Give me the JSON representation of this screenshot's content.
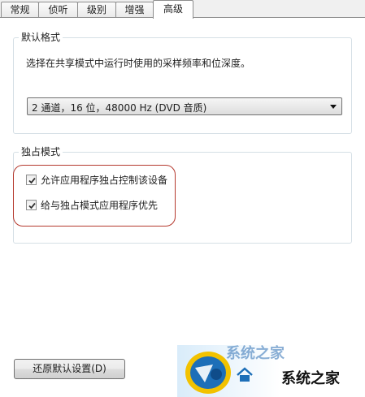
{
  "tabs": [
    {
      "label": "常规"
    },
    {
      "label": "侦听"
    },
    {
      "label": "级别"
    },
    {
      "label": "增强"
    },
    {
      "label": "高级"
    }
  ],
  "active_tab": "高级",
  "default_format": {
    "title": "默认格式",
    "description": "选择在共享模式中运行时使用的采样频率和位深度。",
    "selected": "2 通道，16 位，48000 Hz (DVD 音质)"
  },
  "exclusive_mode": {
    "title": "独占模式",
    "options": [
      {
        "label": "允许应用程序独占控制该设备",
        "checked": true
      },
      {
        "label": "给与独占模式应用程序优先",
        "checked": true
      }
    ]
  },
  "restore_button": {
    "label": "还原默认设置(D)"
  },
  "watermark": {
    "text": "系统之家",
    "partial_text": "系统之家"
  },
  "colors": {
    "highlight": "#b5392e",
    "logo_blue": "#1d6fb8",
    "logo_yellow": "#f2c200"
  }
}
